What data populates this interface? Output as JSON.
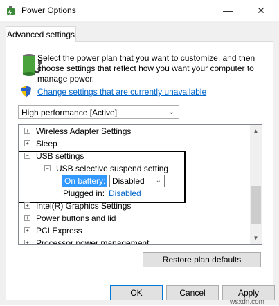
{
  "window": {
    "title": "Power Options",
    "minimize_glyph": "—",
    "close_glyph": "✕"
  },
  "tab": {
    "label": "Advanced settings"
  },
  "description": "Select the power plan that you want to customize, and then choose settings that reflect how you want your computer to manage power.",
  "change_link": "Change settings that are currently unavailable",
  "plan_select": {
    "value": "High performance [Active]"
  },
  "tree": {
    "items": [
      {
        "label": "Wireless Adapter Settings",
        "expander": "+"
      },
      {
        "label": "Sleep",
        "expander": "+"
      },
      {
        "label": "USB settings",
        "expander": "−"
      },
      {
        "label": "USB selective suspend setting",
        "expander": "−"
      },
      {
        "label": "Intel(R) Graphics Settings",
        "expander": "+"
      },
      {
        "label": "Power buttons and lid",
        "expander": "+"
      },
      {
        "label": "PCI Express",
        "expander": "+"
      },
      {
        "label": "Processor power management",
        "expander": "+"
      }
    ],
    "on_battery_label": "On battery:",
    "on_battery_value": "Disabled",
    "plugged_in_label": "Plugged in:",
    "plugged_in_value": "Disabled"
  },
  "buttons": {
    "restore": "Restore plan defaults",
    "ok": "OK",
    "cancel": "Cancel",
    "apply": "Apply"
  },
  "watermark": "wsxdn.com",
  "colors": {
    "accent": "#0066cc",
    "selection": "#3399ff"
  }
}
